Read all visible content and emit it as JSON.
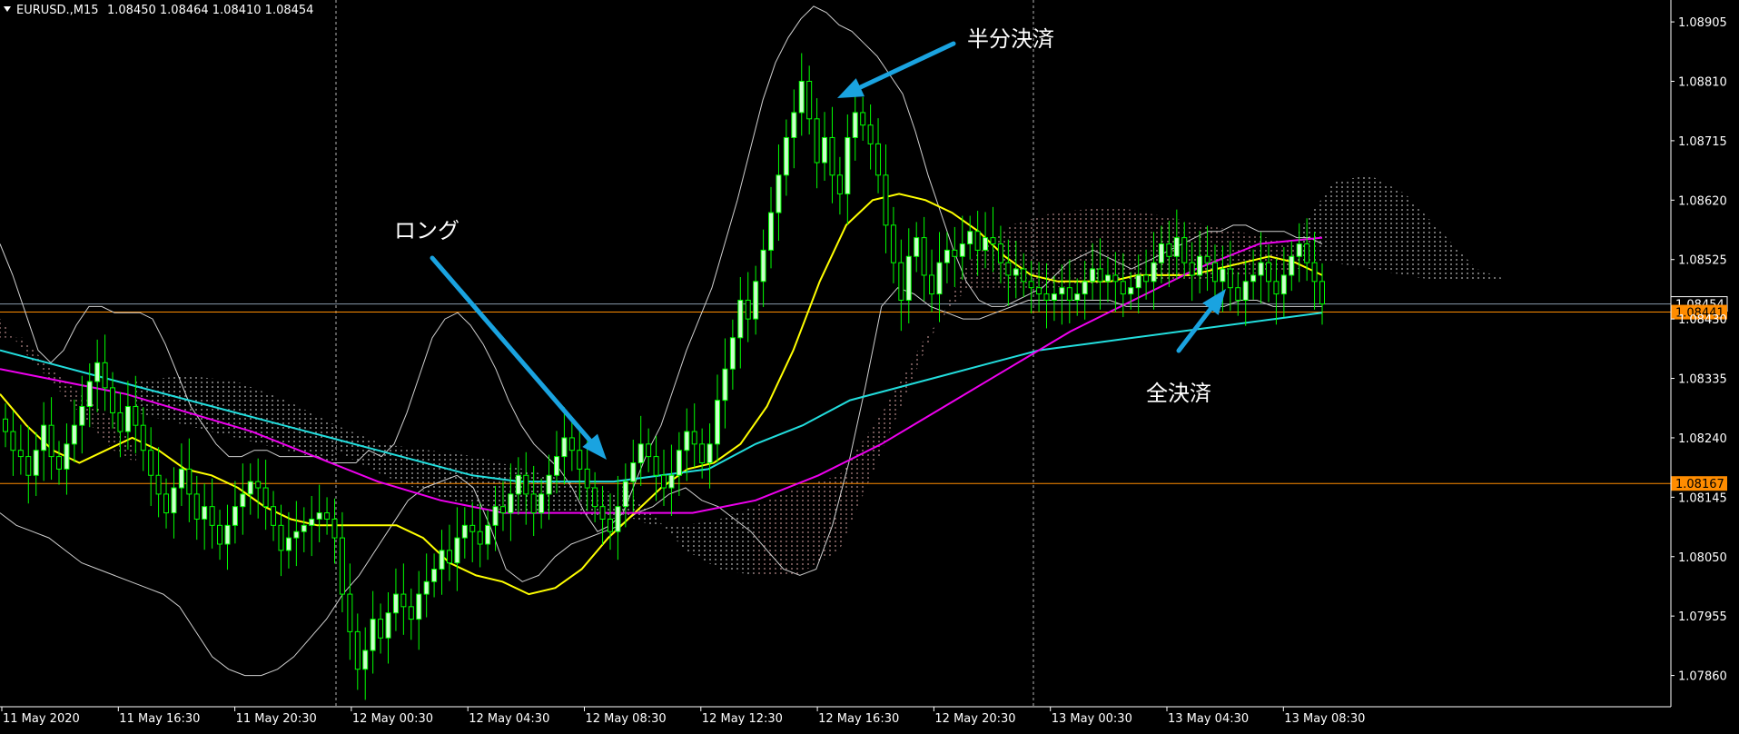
{
  "header": {
    "symbol": "EURUSD.,M15",
    "ohlc": "1.08450 1.08464 1.08410 1.08454",
    "collapse_icon": "triangle-down-icon"
  },
  "colors": {
    "background": "#000000",
    "bull_candle": "#00ff00",
    "bear_candle": "#ffffff",
    "bull_body": "#ccffcc",
    "bollinger": "#cfcfcf",
    "ma_yellow": "#ffff00",
    "ma_cyan": "#22dddd",
    "ma_magenta": "#ee00ee",
    "kumo_up": "#ffc0c0",
    "kumo_down": "#ffffff",
    "hline_orange": "#ff8c00",
    "hline_grey": "#8899aa",
    "arrow": "#1aa3e0"
  },
  "chart_data": {
    "type": "candlestick",
    "ylim": [
      1.0781,
      1.0894
    ],
    "y_ticks": [
      "1.08905",
      "1.08810",
      "1.08715",
      "1.08620",
      "1.08525",
      "1.08430",
      "1.08335",
      "1.08240",
      "1.08145",
      "1.08050",
      "1.07955",
      "1.07860"
    ],
    "x_ticks": [
      "11 May 2020",
      "11 May 16:30",
      "11 May 20:30",
      "12 May 00:30",
      "12 May 04:30",
      "12 May 08:30",
      "12 May 12:30",
      "12 May 16:30",
      "12 May 20:30",
      "13 May 00:30",
      "13 May 04:30",
      "13 May 08:30"
    ],
    "price_line": {
      "label": "1.08454",
      "value": 1.08454
    },
    "hlines": [
      {
        "label": "1.08441",
        "value": 1.08441
      },
      {
        "label": "1.08167",
        "value": 1.08167
      }
    ],
    "annotations": {
      "half_close": "半分決済",
      "long_entry": "ロング",
      "full_close": "全決済"
    },
    "close": [
      1.0825,
      1.0822,
      1.0821,
      1.0818,
      1.0822,
      1.0826,
      1.0821,
      1.0819,
      1.0823,
      1.0826,
      1.0829,
      1.0833,
      1.0836,
      1.0832,
      1.0828,
      1.0825,
      1.0829,
      1.0826,
      1.0822,
      1.0818,
      1.0815,
      1.0812,
      1.0816,
      1.0819,
      1.0815,
      1.0811,
      1.0813,
      1.081,
      1.0807,
      1.081,
      1.0813,
      1.0815,
      1.0817,
      1.0816,
      1.0813,
      1.081,
      1.0806,
      1.0808,
      1.0809,
      1.081,
      1.0811,
      1.0812,
      1.0811,
      1.0808,
      1.0799,
      1.0793,
      1.0787,
      1.079,
      1.0795,
      1.0792,
      1.0796,
      1.0799,
      1.0797,
      1.0795,
      1.0799,
      1.0801,
      1.0803,
      1.0806,
      1.0804,
      1.0808,
      1.081,
      1.0809,
      1.0807,
      1.081,
      1.0813,
      1.0812,
      1.0815,
      1.0818,
      1.0815,
      1.0812,
      1.0815,
      1.0818,
      1.0821,
      1.0824,
      1.0822,
      1.0819,
      1.0816,
      1.0813,
      1.0811,
      1.0809,
      1.0813,
      1.0817,
      1.082,
      1.0823,
      1.0821,
      1.0818,
      1.0816,
      1.0818,
      1.0822,
      1.0825,
      1.0823,
      1.082,
      1.0823,
      1.083,
      1.0835,
      1.084,
      1.0846,
      1.0843,
      1.0849,
      1.0854,
      1.086,
      1.0866,
      1.0872,
      1.0876,
      1.0881,
      1.0875,
      1.0868,
      1.0872,
      1.0866,
      1.0863,
      1.0872,
      1.0876,
      1.0874,
      1.0871,
      1.0866,
      1.0858,
      1.0852,
      1.0846,
      1.0853,
      1.0856,
      1.085,
      1.0847,
      1.0852,
      1.0854,
      1.0853,
      1.0855,
      1.0857,
      1.0854,
      1.0856,
      1.0855,
      1.0852,
      1.085,
      1.0851,
      1.0849,
      1.0848,
      1.0847,
      1.0846,
      1.0847,
      1.0848,
      1.0846,
      1.0847,
      1.0849,
      1.0851,
      1.0849,
      1.085,
      1.0849,
      1.0847,
      1.0848,
      1.085,
      1.0849,
      1.0852,
      1.0855,
      1.0853,
      1.0856,
      1.0852,
      1.085,
      1.0853,
      1.0852,
      1.0849,
      1.0851,
      1.0848,
      1.0846,
      1.0849,
      1.085,
      1.0852,
      1.0849,
      1.0847,
      1.085,
      1.0853,
      1.0855,
      1.0852,
      1.0849,
      1.08454
    ],
    "upper_band": [
      1.0855,
      1.085,
      1.0844,
      1.0838,
      1.0836,
      1.0838,
      1.0842,
      1.0845,
      1.0845,
      1.0844,
      1.0844,
      1.0844,
      1.0843,
      1.0839,
      1.0834,
      1.0829,
      1.0826,
      1.0823,
      1.0821,
      1.0821,
      1.0822,
      1.0822,
      1.0821,
      1.0821,
      1.0821,
      1.0821,
      1.082,
      1.082,
      1.082,
      1.0822,
      1.0821,
      1.0823,
      1.0828,
      1.0834,
      1.084,
      1.0843,
      1.0844,
      1.0842,
      1.0839,
      1.0835,
      1.083,
      1.0826,
      1.0823,
      1.0821,
      1.0819,
      1.0816,
      1.0812,
      1.0809,
      1.081,
      1.0812,
      1.0817,
      1.0822,
      1.0826,
      1.0832,
      1.0838,
      1.0843,
      1.0848,
      1.0855,
      1.0862,
      1.087,
      1.0878,
      1.0884,
      1.0888,
      1.0891,
      1.0893,
      1.0892,
      1.089,
      1.0889,
      1.0887,
      1.0885,
      1.0882,
      1.0879,
      1.0873,
      1.0866,
      1.086,
      1.0854,
      1.0849,
      1.0846,
      1.0845,
      1.0845,
      1.0846,
      1.0847,
      1.0848,
      1.085,
      1.0852,
      1.0853,
      1.0854,
      1.0853,
      1.0852,
      1.0851,
      1.0852,
      1.0853,
      1.0854,
      1.0855,
      1.0856,
      1.0857,
      1.0857,
      1.0858,
      1.0858,
      1.0857,
      1.0857,
      1.0857,
      1.0856,
      1.0856,
      1.0855
    ],
    "lower_band": [
      1.0812,
      1.081,
      1.0809,
      1.0808,
      1.0806,
      1.0804,
      1.0803,
      1.0802,
      1.0801,
      1.08,
      1.0799,
      1.0797,
      1.0793,
      1.0789,
      1.0787,
      1.0786,
      1.0786,
      1.0787,
      1.0789,
      1.0792,
      1.0795,
      1.0799,
      1.0802,
      1.0806,
      1.081,
      1.0814,
      1.0816,
      1.0817,
      1.0818,
      1.0816,
      1.081,
      1.0803,
      1.0801,
      1.0802,
      1.0805,
      1.0807,
      1.0808,
      1.0809,
      1.081,
      1.0812,
      1.0813,
      1.0815,
      1.0816,
      1.0814,
      1.0813,
      1.0811,
      1.0809,
      1.0806,
      1.0803,
      1.0802,
      1.0803,
      1.081,
      1.082,
      1.0832,
      1.0845,
      1.0848,
      1.0847,
      1.0845,
      1.0844,
      1.0843,
      1.0843,
      1.0844,
      1.0845,
      1.0846,
      1.0846,
      1.0846,
      1.0846,
      1.0846,
      1.0846,
      1.0845,
      1.0845,
      1.0845,
      1.0845,
      1.0845,
      1.0845,
      1.0845,
      1.0846,
      1.0846,
      1.0845,
      1.0845,
      1.0845,
      1.0845
    ],
    "ma_yellow": [
      1.0831,
      1.0826,
      1.0822,
      1.082,
      1.0822,
      1.0824,
      1.0822,
      1.0819,
      1.0818,
      1.0816,
      1.0813,
      1.0811,
      1.081,
      1.081,
      1.081,
      1.081,
      1.0808,
      1.0804,
      1.0802,
      1.0801,
      1.0799,
      1.08,
      1.0803,
      1.0808,
      1.0812,
      1.0816,
      1.0819,
      1.082,
      1.0823,
      1.0829,
      1.0838,
      1.0849,
      1.0858,
      1.0862,
      1.0863,
      1.0862,
      1.086,
      1.0857,
      1.0853,
      1.085,
      1.0849,
      1.0849,
      1.0849,
      1.085,
      1.085,
      1.085,
      1.0851,
      1.0852,
      1.0853,
      1.0852,
      1.085
    ],
    "ma_cyan": [
      1.0838,
      1.0836,
      1.0834,
      1.0832,
      1.083,
      1.0828,
      1.0826,
      1.0824,
      1.0822,
      1.082,
      1.0818,
      1.0817,
      1.0817,
      1.0817,
      1.0818,
      1.0819,
      1.0823,
      1.0826,
      1.083,
      1.0832,
      1.0834,
      1.0836,
      1.0838,
      1.0839,
      1.084,
      1.0841,
      1.0842,
      1.0843,
      1.0844
    ],
    "ma_magenta": [
      1.0835,
      1.0833,
      1.0831,
      1.0828,
      1.0825,
      1.0821,
      1.0817,
      1.0814,
      1.0812,
      1.0812,
      1.0812,
      1.0812,
      1.0814,
      1.0818,
      1.0823,
      1.0829,
      1.0835,
      1.0841,
      1.0846,
      1.0851,
      1.0855,
      1.0856
    ]
  }
}
